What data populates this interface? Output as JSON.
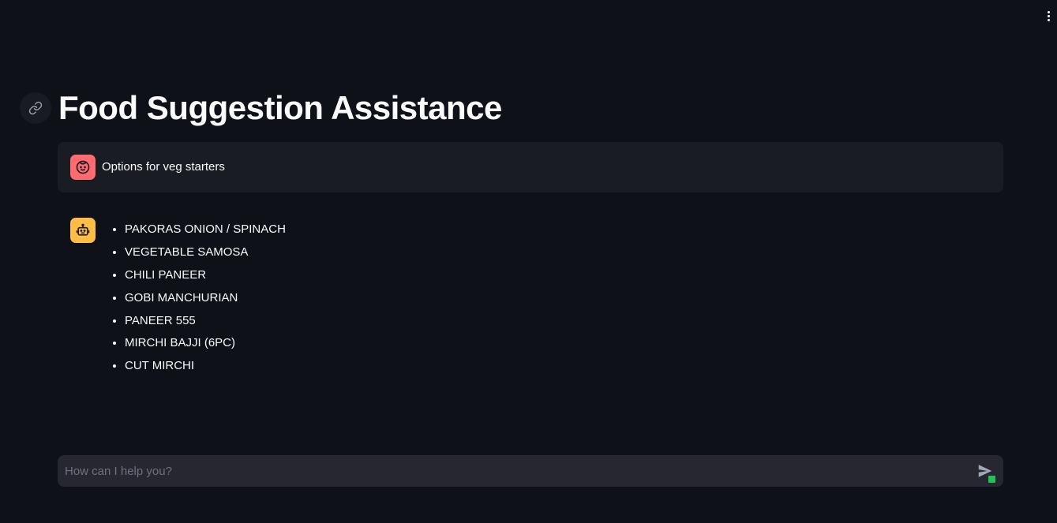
{
  "header": {
    "menu_icon": "kebab-menu-icon"
  },
  "page": {
    "title": "Food Suggestion Assistance",
    "anchor_icon": "link-icon"
  },
  "messages": {
    "user": {
      "avatar_icon": "user-face-icon",
      "avatar_color": "#ff6b6f",
      "text": "Options for veg starters"
    },
    "assistant": {
      "avatar_icon": "robot-icon",
      "avatar_color": "#ffbd45",
      "items": [
        "PAKORAS ONION / SPINACH",
        "VEGETABLE SAMOSA",
        "CHILI PANEER",
        "GOBI MANCHURIAN",
        "PANEER 555",
        "MIRCHI BAJJI (6PC)",
        "CUT MIRCHI"
      ]
    }
  },
  "chat_input": {
    "placeholder": "How can I help you?",
    "value": "",
    "send_icon": "send-icon",
    "status_color": "#21c354"
  },
  "colors": {
    "background": "#0e1117",
    "user_bubble": "#1a1c24",
    "input_bg": "#262730"
  }
}
